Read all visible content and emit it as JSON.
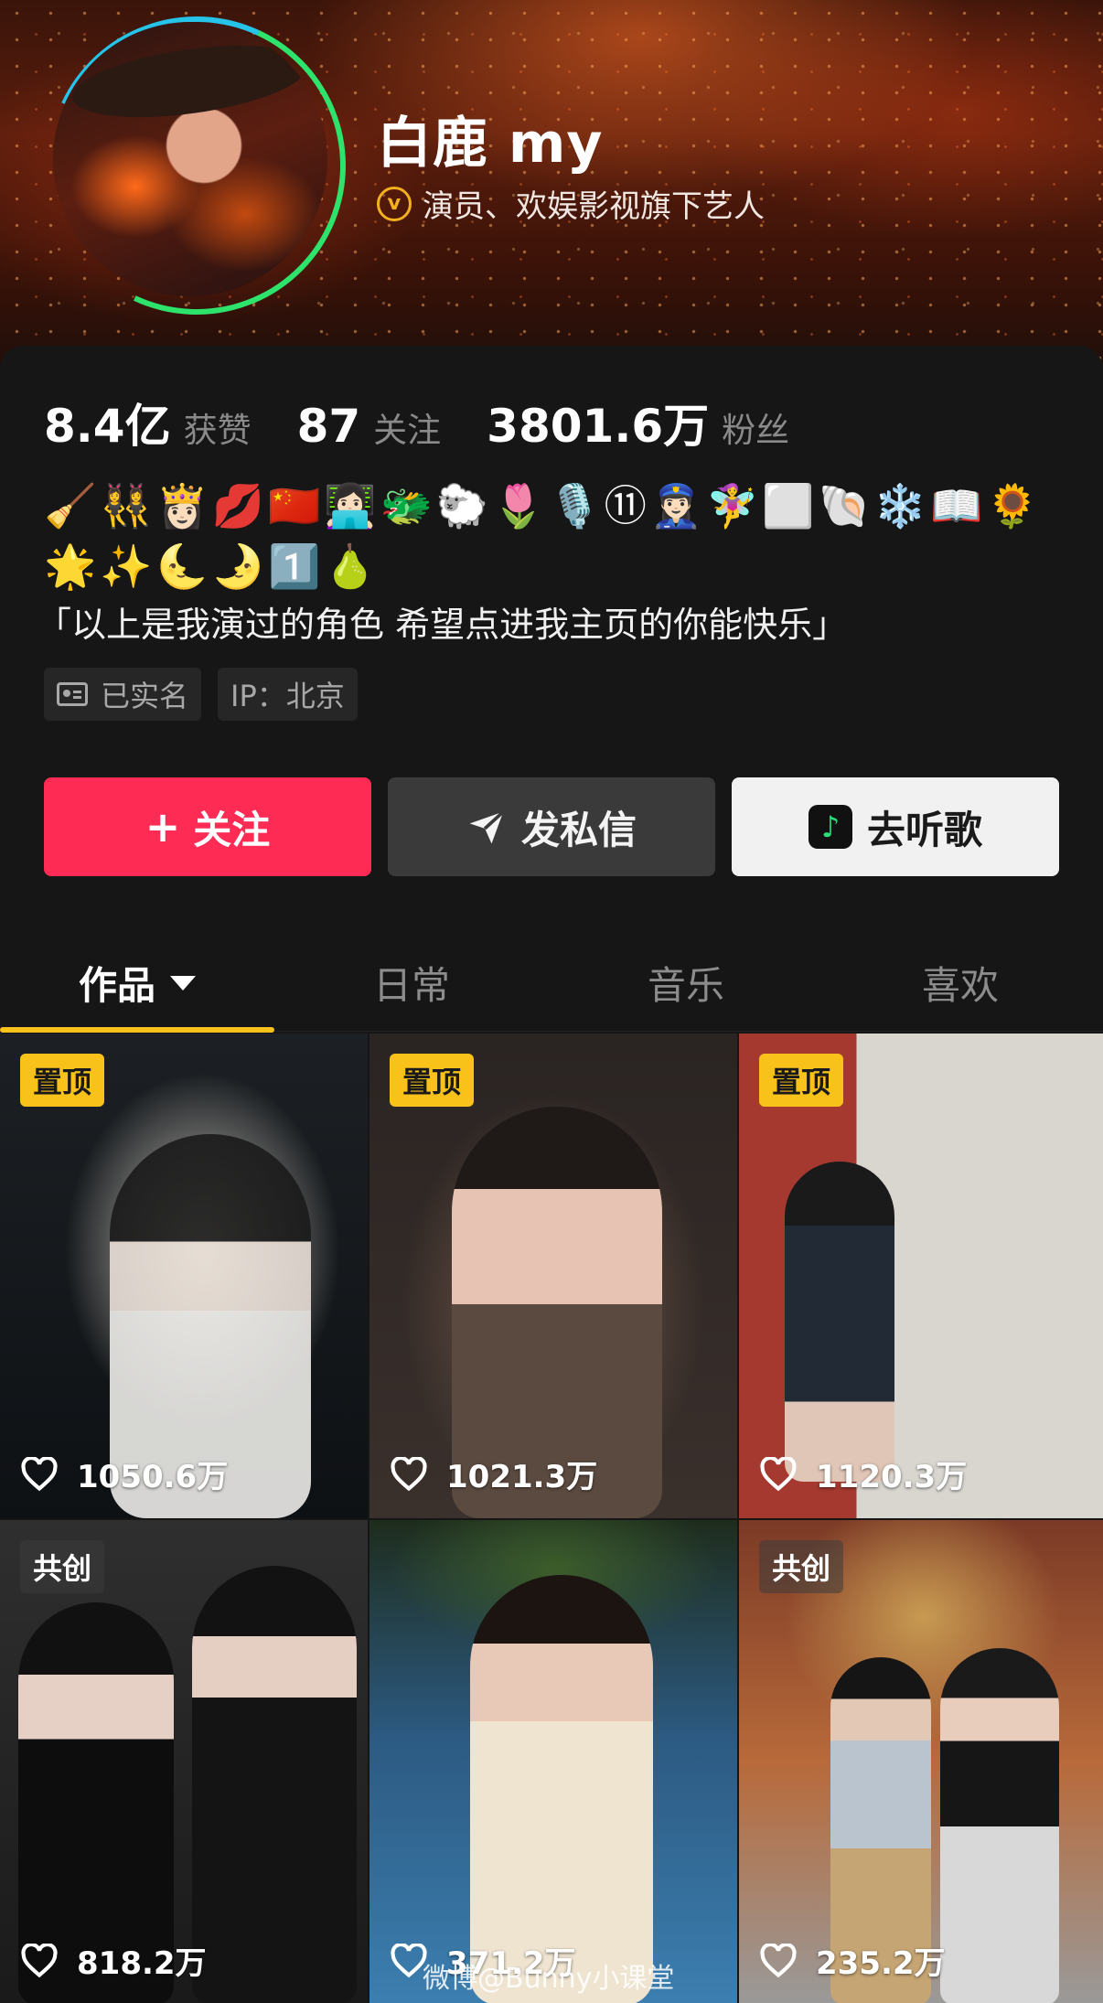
{
  "profile": {
    "name": "白鹿 my",
    "verified_tag": "演员、欢娱影视旗下艺人",
    "verified_icon": "v"
  },
  "stats": [
    {
      "value": "8.4亿",
      "label": "获赞"
    },
    {
      "value": "87",
      "label": "关注"
    },
    {
      "value": "3801.6万",
      "label": "粉丝"
    }
  ],
  "emojis": "🧹👯‍♀️👸🏻💋🇨🇳👩🏻‍💻🐲🐑🌷🎙️⑪👮🏻‍♀️🧚‍♀️⬜🐚❄️📖🌻🌟✨🌜🌛1️⃣🍐",
  "bio": "「以上是我演过的角色 希望点进我主页的你能快乐」",
  "chips": {
    "verified": "已实名",
    "ip": "IP：北京"
  },
  "actions": {
    "follow": "关注",
    "follow_icon": "+",
    "message": "发私信",
    "music": "去听歌"
  },
  "tabs": [
    "作品",
    "日常",
    "音乐",
    "喜欢"
  ],
  "videos": [
    {
      "badge": "置顶",
      "likes": "1050.6万"
    },
    {
      "badge": "置顶",
      "likes": "1021.3万"
    },
    {
      "badge": "置顶",
      "likes": "1120.3万"
    },
    {
      "badge": "共创",
      "likes": "818.2万"
    },
    {
      "badge": "",
      "likes": "371.2万"
    },
    {
      "badge": "共创",
      "likes": "235.2万"
    }
  ],
  "watermark": "微博@Bunny小课堂",
  "colors": {
    "follow_button": "#fe2c55",
    "accent_yellow": "#f8c21b",
    "verified_gold": "#f3b11f",
    "music_green": "#26e07a"
  }
}
